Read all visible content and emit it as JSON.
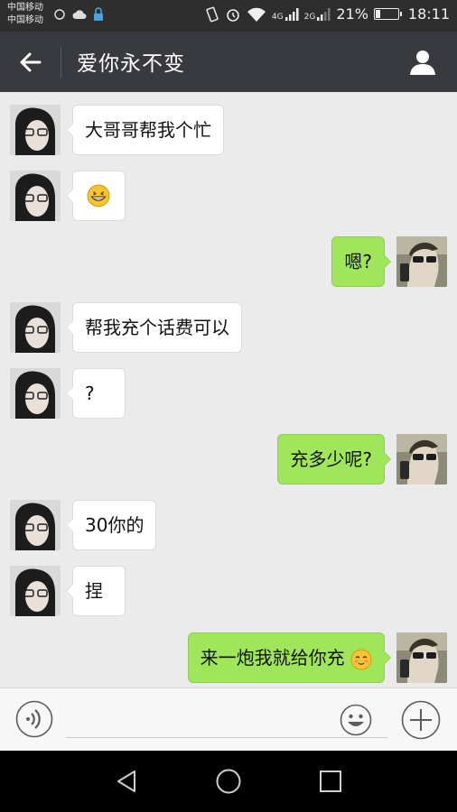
{
  "status_bar": {
    "carrier_1": "中国移动",
    "carrier_2": "中国移动",
    "net_1": "4G",
    "net_2": "2G",
    "battery_percent": "21%",
    "battery_level": 0.21,
    "time": "18:11",
    "icons": [
      "weather-icon",
      "cloud-icon",
      "lock-icon",
      "vibrate-icon",
      "alarm-icon",
      "wifi-icon",
      "signal-icon",
      "signal-icon",
      "battery-icon"
    ]
  },
  "header": {
    "title": "爱你永不变",
    "icons": [
      "back-arrow-icon",
      "profile-icon"
    ]
  },
  "messages": [
    {
      "side": "left",
      "text": "大哥哥帮我个忙"
    },
    {
      "side": "left",
      "emoji": "grinning-emoji"
    },
    {
      "side": "right",
      "text": "嗯?"
    },
    {
      "side": "left",
      "text": "帮我充个话费可以"
    },
    {
      "side": "left",
      "text": "?"
    },
    {
      "side": "right",
      "text": "充多少呢?"
    },
    {
      "side": "left",
      "text": "30你的"
    },
    {
      "side": "left",
      "text": "捏"
    },
    {
      "side": "right",
      "text": "来一炮我就给你充",
      "emoji": "blush-emoji"
    }
  ],
  "input_bar": {
    "icons": [
      "voice-icon",
      "emoji-icon",
      "plus-icon"
    ]
  },
  "nav_bar": {
    "icons": [
      "nav-back-icon",
      "nav-home-icon",
      "nav-recent-icon"
    ]
  },
  "colors": {
    "header_bg": "#393a3f",
    "chat_bg": "#ebebeb",
    "sent_bubble": "#9fe65a",
    "received_bubble": "#ffffff"
  }
}
